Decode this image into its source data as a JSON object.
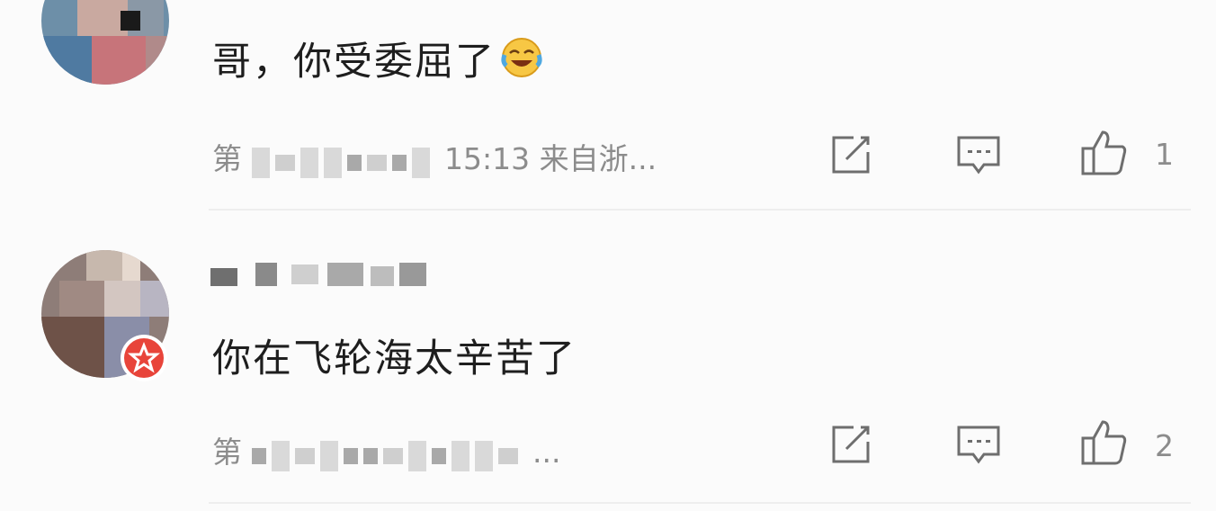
{
  "comments": [
    {
      "text": "哥，你受委屈了",
      "emoji_icon": "laughing-tears-icon",
      "meta_prefix": "第",
      "meta_time": "15:13",
      "meta_location": "来自浙...",
      "like_count": "1"
    },
    {
      "text": "你在飞轮海太辛苦了",
      "meta_prefix": "第",
      "meta_location": "...",
      "like_count": "2",
      "badge_icon": "vip-star-badge-icon"
    }
  ],
  "icons": {
    "edit": "edit-icon",
    "reply": "comment-bubble-icon",
    "like": "thumbs-up-icon"
  },
  "colors": {
    "text": "#1e1e1e",
    "meta": "#8c8c8c",
    "badge": "#e8443a",
    "background": "#fbfbfb"
  }
}
